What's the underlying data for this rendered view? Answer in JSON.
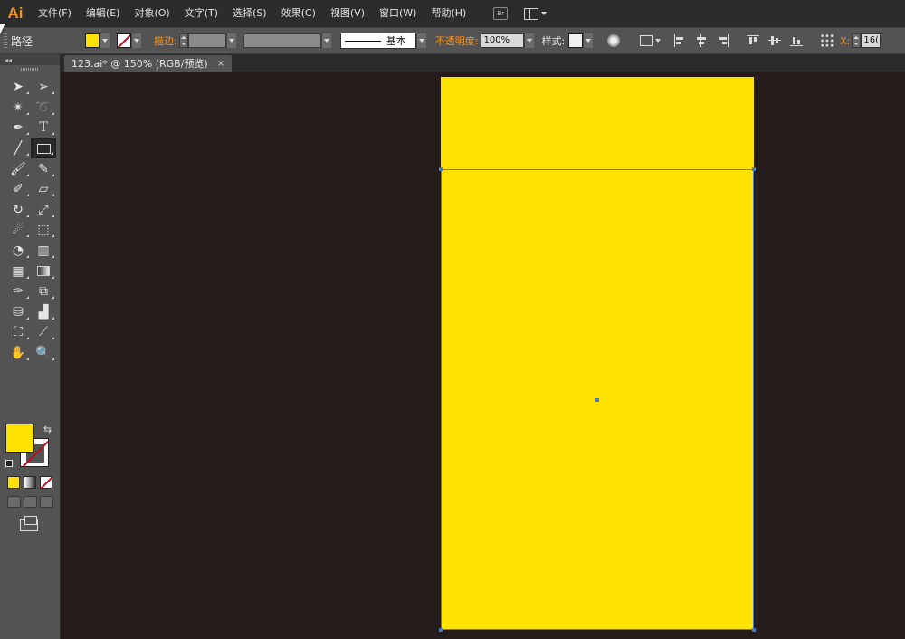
{
  "app": {
    "logo": "Ai"
  },
  "menu": [
    "文件(F)",
    "编辑(E)",
    "对象(O)",
    "文字(T)",
    "选择(S)",
    "效果(C)",
    "视图(V)",
    "窗口(W)",
    "帮助(H)"
  ],
  "menu_extra": {
    "bridge": "Br"
  },
  "control": {
    "selection_label": "路径",
    "stroke_label": "描边:",
    "stroke_style_label": "基本",
    "opacity_label": "不透明度:",
    "opacity_value": "100%",
    "style_label": "样式:",
    "x_label": "X:",
    "x_value": "16("
  },
  "document_tab": {
    "title": "123.ai* @ 150% (RGB/预览)",
    "close": "×"
  },
  "colors": {
    "fill": "#ffe100",
    "stroke": "none",
    "accent": "#f7931e",
    "selection": "#4a78c8"
  },
  "tools": [
    [
      "selection-tool",
      "direct-selection-tool"
    ],
    [
      "magic-wand-tool",
      "lasso-tool"
    ],
    [
      "pen-tool",
      "type-tool"
    ],
    [
      "line-segment-tool",
      "rectangle-tool"
    ],
    [
      "paintbrush-tool",
      "pencil-tool"
    ],
    [
      "blob-brush-tool",
      "eraser-tool"
    ],
    [
      "rotate-tool",
      "scale-tool"
    ],
    [
      "warp-tool",
      "free-transform-tool"
    ],
    [
      "shape-builder-tool",
      "perspective-grid-tool"
    ],
    [
      "mesh-tool",
      "gradient-tool"
    ],
    [
      "eyedropper-tool",
      "blend-tool"
    ],
    [
      "symbol-sprayer-tool",
      "column-graph-tool"
    ],
    [
      "artboard-tool",
      "slice-tool"
    ],
    [
      "hand-tool",
      "zoom-tool"
    ]
  ]
}
